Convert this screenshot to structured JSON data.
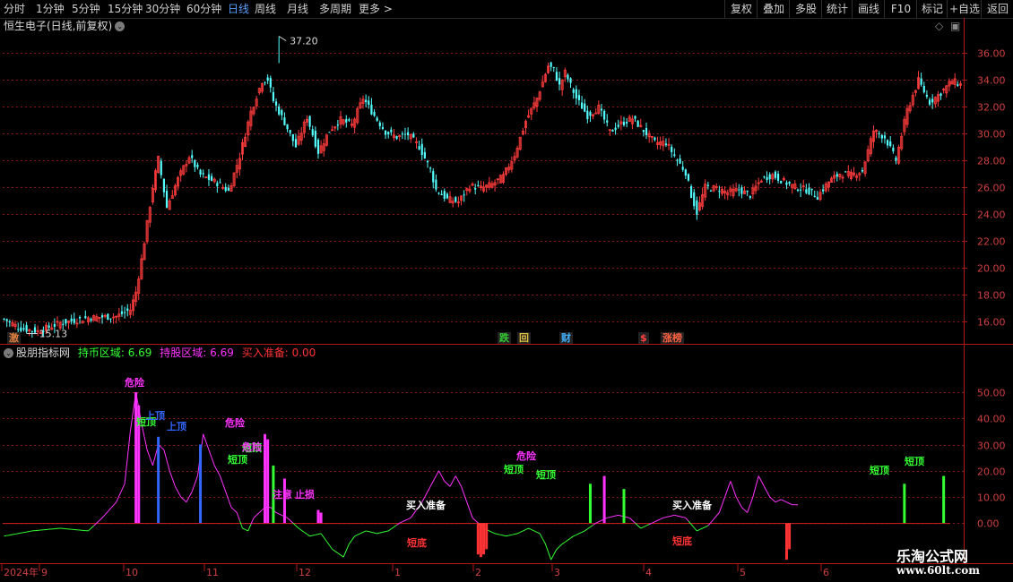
{
  "toolbar": {
    "periods": [
      "分时",
      "1分钟",
      "5分钟",
      "15分钟",
      "30分钟",
      "60分钟",
      "日线",
      "周线",
      "月线",
      "多周期",
      "更多 >"
    ],
    "active_period": "日线",
    "right_buttons": [
      "复权",
      "叠加",
      "多股",
      "统计",
      "画线",
      "F10",
      "标记",
      "+自选",
      "返回"
    ]
  },
  "main_panel": {
    "title": "恒生电子(日线,前复权)",
    "high_label": "37.20",
    "low_label": "15.13",
    "event_badges": [
      {
        "text": "激",
        "color": "#e08040",
        "date_index": 3
      },
      {
        "text": "跌",
        "color": "#33cc33",
        "date_index": 178
      },
      {
        "text": "回",
        "color": "#e0c040",
        "date_index": 185
      },
      {
        "text": "财",
        "color": "#40b0ff",
        "date_index": 200
      },
      {
        "text": "$",
        "color": "#ff4040",
        "date_index": 228
      },
      {
        "text": "涨榜",
        "color": "#ff6040",
        "date_index": 236
      }
    ]
  },
  "indicator_panel": {
    "name": "股朋指标网",
    "hold_coin": {
      "label": "持币区域:",
      "value": "6.69",
      "color": "#33ff33"
    },
    "hold_stock": {
      "label": "持股区域:",
      "value": "6.69",
      "color": "#ff33ff"
    },
    "buy_ready": {
      "label": "买入准备:",
      "value": "0.00",
      "color": "#ff3333"
    },
    "signals": [
      {
        "text": "危险",
        "color": "#ff33ff"
      },
      {
        "text": "短顶",
        "color": "#33ff33"
      },
      {
        "text": "上顶",
        "color": "#3366ff"
      },
      {
        "text": "上顶",
        "color": "#3366ff"
      },
      {
        "text": "短顶",
        "color": "#33ff33"
      },
      {
        "text": "危险",
        "color": "#ff33ff"
      },
      {
        "text": "短顶",
        "color": "#33ff33"
      },
      {
        "text": "危险",
        "color": "#ff33ff"
      },
      {
        "text": "注意",
        "color": "#ff33ff"
      },
      {
        "text": "止损",
        "color": "#ff33ff"
      },
      {
        "text": "买入准备",
        "color": "#ffffff"
      },
      {
        "text": "短底",
        "color": "#ff3333"
      },
      {
        "text": "短顶",
        "color": "#33ff33"
      },
      {
        "text": "危险",
        "color": "#ff33ff"
      },
      {
        "text": "短顶",
        "color": "#33ff33"
      },
      {
        "text": "买入准备",
        "color": "#ffffff"
      },
      {
        "text": "短底",
        "color": "#ff3333"
      },
      {
        "text": "短顶",
        "color": "#33ff33"
      },
      {
        "text": "短顶",
        "color": "#33ff33"
      }
    ]
  },
  "x_axis": {
    "labels": [
      "2024年",
      "9",
      "10",
      "11",
      "12",
      "1",
      "2",
      "3",
      "4",
      "5",
      "6"
    ]
  },
  "watermark": {
    "name": "乐淘公式网",
    "url": "www.60lt.com"
  },
  "chart_data": [
    {
      "type": "candlestick",
      "title": "恒生电子(日线,前复权)",
      "ylim": [
        14.5,
        37.5
      ],
      "yticks": [
        16.0,
        18.0,
        20.0,
        22.0,
        24.0,
        26.0,
        28.0,
        30.0,
        32.0,
        34.0,
        36.0
      ],
      "grid": true,
      "anchor_closes": [
        [
          0,
          16.2
        ],
        [
          6,
          15.5
        ],
        [
          12,
          15.3
        ],
        [
          20,
          15.9
        ],
        [
          30,
          16.3
        ],
        [
          40,
          16.4
        ],
        [
          45,
          16.9
        ],
        [
          47,
          18.2
        ],
        [
          49,
          20.6
        ],
        [
          53,
          26.0
        ],
        [
          55,
          28.1
        ],
        [
          58,
          24.5
        ],
        [
          62,
          26.6
        ],
        [
          66,
          28.3
        ],
        [
          70,
          26.9
        ],
        [
          76,
          26.3
        ],
        [
          80,
          25.7
        ],
        [
          84,
          28.3
        ],
        [
          88,
          31.6
        ],
        [
          92,
          33.9
        ],
        [
          94,
          34.0
        ],
        [
          96,
          32.4
        ],
        [
          100,
          30.8
        ],
        [
          104,
          29.0
        ],
        [
          108,
          31.2
        ],
        [
          112,
          28.6
        ],
        [
          116,
          30.2
        ],
        [
          120,
          31.0
        ],
        [
          124,
          30.6
        ],
        [
          128,
          32.6
        ],
        [
          132,
          31.3
        ],
        [
          136,
          30.1
        ],
        [
          140,
          29.7
        ],
        [
          144,
          29.9
        ],
        [
          148,
          29.0
        ],
        [
          152,
          27.3
        ],
        [
          154,
          25.8
        ],
        [
          158,
          25.1
        ],
        [
          162,
          24.9
        ],
        [
          166,
          26.1
        ],
        [
          170,
          25.9
        ],
        [
          174,
          26.2
        ],
        [
          178,
          26.8
        ],
        [
          182,
          28.4
        ],
        [
          186,
          30.9
        ],
        [
          190,
          32.6
        ],
        [
          194,
          35.0
        ],
        [
          196,
          34.7
        ],
        [
          198,
          33.5
        ],
        [
          200,
          34.5
        ],
        [
          204,
          32.6
        ],
        [
          208,
          31.3
        ],
        [
          212,
          31.9
        ],
        [
          216,
          30.1
        ],
        [
          220,
          30.7
        ],
        [
          224,
          31.1
        ],
        [
          228,
          30.2
        ],
        [
          232,
          29.3
        ],
        [
          236,
          29.3
        ],
        [
          240,
          28.0
        ],
        [
          243,
          27.1
        ],
        [
          245,
          25.4
        ],
        [
          247,
          24.1
        ],
        [
          250,
          26.0
        ],
        [
          254,
          25.9
        ],
        [
          258,
          25.6
        ],
        [
          262,
          25.8
        ],
        [
          266,
          25.4
        ],
        [
          270,
          26.6
        ],
        [
          274,
          26.9
        ],
        [
          278,
          26.4
        ],
        [
          282,
          26.0
        ],
        [
          286,
          25.8
        ],
        [
          290,
          25.3
        ],
        [
          294,
          26.4
        ],
        [
          298,
          27.0
        ],
        [
          302,
          26.9
        ],
        [
          306,
          27.2
        ],
        [
          310,
          30.2
        ],
        [
          314,
          29.7
        ],
        [
          318,
          28.0
        ],
        [
          322,
          31.7
        ],
        [
          326,
          33.9
        ],
        [
          330,
          32.3
        ],
        [
          334,
          33.0
        ],
        [
          338,
          33.9
        ],
        [
          341,
          33.6
        ]
      ]
    },
    {
      "type": "line",
      "title": "股朋指标网",
      "ylim": [
        -15,
        62
      ],
      "yticks": [
        50.0,
        40.0,
        30.0,
        20.0,
        10.0,
        0.0
      ],
      "grid": true,
      "anchor_values": [
        [
          0,
          -5
        ],
        [
          10,
          -3
        ],
        [
          20,
          -2
        ],
        [
          30,
          -3
        ],
        [
          35,
          2
        ],
        [
          40,
          8
        ],
        [
          43,
          15
        ],
        [
          45,
          35
        ],
        [
          47,
          50
        ],
        [
          49,
          38
        ],
        [
          51,
          28
        ],
        [
          53,
          22
        ],
        [
          55,
          30
        ],
        [
          57,
          28
        ],
        [
          59,
          20
        ],
        [
          61,
          14
        ],
        [
          63,
          10
        ],
        [
          65,
          8
        ],
        [
          67,
          12
        ],
        [
          69,
          18
        ],
        [
          71,
          34
        ],
        [
          73,
          28
        ],
        [
          75,
          22
        ],
        [
          77,
          18
        ],
        [
          79,
          12
        ],
        [
          81,
          6
        ],
        [
          83,
          4
        ],
        [
          85,
          -2
        ],
        [
          87,
          -3
        ],
        [
          89,
          2
        ],
        [
          91,
          4
        ],
        [
          93,
          6
        ],
        [
          95,
          6
        ],
        [
          97,
          4
        ],
        [
          101,
          2
        ],
        [
          105,
          -2
        ],
        [
          109,
          -5
        ],
        [
          113,
          -4
        ],
        [
          117,
          -10
        ],
        [
          121,
          -13
        ],
        [
          123,
          -8
        ],
        [
          125,
          -5
        ],
        [
          129,
          -3
        ],
        [
          133,
          -4
        ],
        [
          137,
          -3
        ],
        [
          141,
          0
        ],
        [
          145,
          2
        ],
        [
          149,
          8
        ],
        [
          153,
          16
        ],
        [
          155,
          20
        ],
        [
          157,
          16
        ],
        [
          159,
          14
        ],
        [
          161,
          18
        ],
        [
          163,
          14
        ],
        [
          165,
          8
        ],
        [
          167,
          2
        ],
        [
          169,
          0
        ],
        [
          171,
          -2
        ],
        [
          175,
          -4
        ],
        [
          179,
          -5
        ],
        [
          183,
          -4
        ],
        [
          187,
          -2
        ],
        [
          191,
          -4
        ],
        [
          193,
          -8
        ],
        [
          195,
          -14
        ],
        [
          197,
          -10
        ],
        [
          199,
          -8
        ],
        [
          203,
          -5
        ],
        [
          207,
          -3
        ],
        [
          211,
          0
        ],
        [
          215,
          2
        ],
        [
          219,
          3
        ],
        [
          223,
          2
        ],
        [
          227,
          -2
        ],
        [
          231,
          0
        ],
        [
          235,
          2
        ],
        [
          239,
          3
        ],
        [
          243,
          2
        ],
        [
          247,
          -3
        ],
        [
          251,
          -1
        ],
        [
          255,
          4
        ],
        [
          259,
          16
        ],
        [
          261,
          10
        ],
        [
          263,
          6
        ],
        [
          265,
          4
        ],
        [
          267,
          10
        ],
        [
          269,
          18
        ],
        [
          271,
          14
        ],
        [
          273,
          10
        ],
        [
          275,
          8
        ],
        [
          277,
          9
        ],
        [
          279,
          8
        ],
        [
          281,
          7
        ]
      ]
    }
  ]
}
